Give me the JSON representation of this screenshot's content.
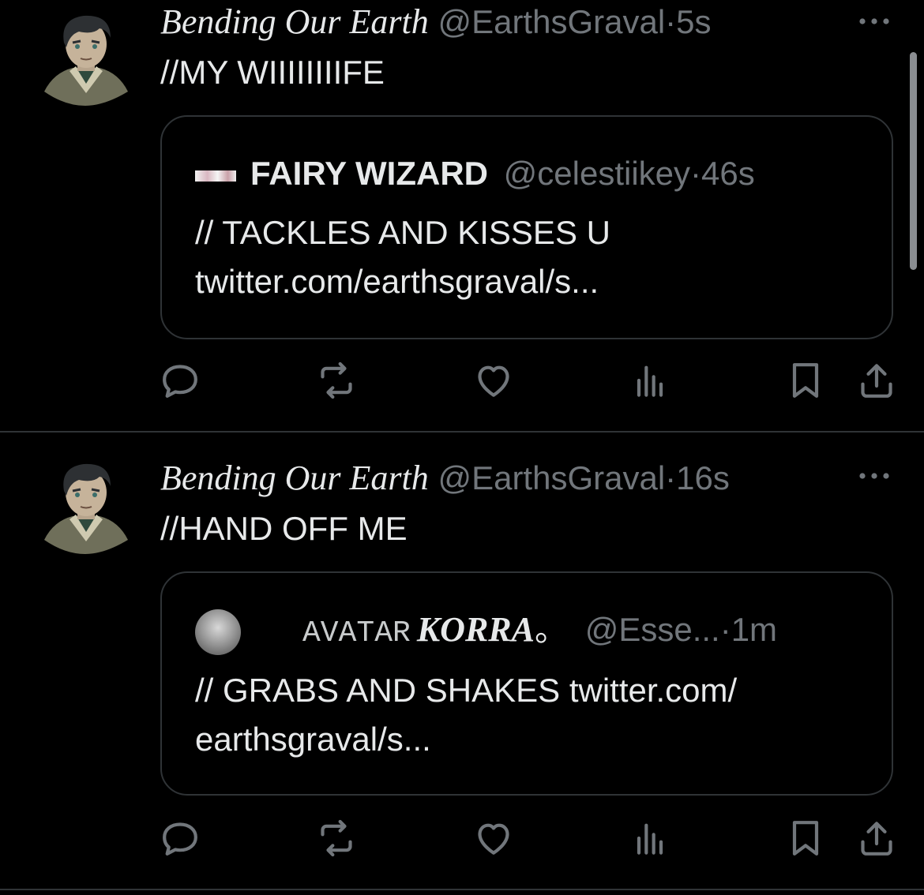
{
  "colors": {
    "background": "#000000",
    "primary_text": "#e7e9ea",
    "secondary_text": "#71767b",
    "border": "#2f3336"
  },
  "tweets": [
    {
      "display_name": "Bending Our Earth",
      "handle": "@EarthsGraval",
      "separator": "·",
      "time": "5s",
      "text": "//MY WIIIIIIIIFE",
      "avatar_icon": "cartoon-avatar",
      "quote": {
        "name_prefix": "",
        "name": "FAIRY WIZARD",
        "name_suffix": "",
        "handle": "@celestiikey",
        "separator": "·",
        "time": "46s",
        "avatar_icon": "banner-avatar",
        "text_lines": [
          "// TACKLES AND KISSES U",
          "twitter.com/earthsgraval/s..."
        ]
      },
      "actions": [
        "reply-icon",
        "retweet-icon",
        "like-icon",
        "views-icon",
        "bookmark-icon",
        "share-icon"
      ]
    },
    {
      "display_name": "Bending Our Earth",
      "handle": "@EarthsGraval",
      "separator": "·",
      "time": "16s",
      "text": "//HAND OFF ME",
      "avatar_icon": "cartoon-avatar",
      "quote": {
        "name_prefix": "AVATAR",
        "name": "KORRA",
        "name_suffix": "。",
        "handle": "@Esse...",
        "separator": "·",
        "time": "1m",
        "avatar_icon": "round-photo-avatar",
        "text_lines": [
          "// GRABS AND SHAKES twitter.com/",
          "earthsgraval/s..."
        ]
      },
      "actions": [
        "reply-icon",
        "retweet-icon",
        "like-icon",
        "views-icon",
        "bookmark-icon",
        "share-icon"
      ]
    }
  ]
}
